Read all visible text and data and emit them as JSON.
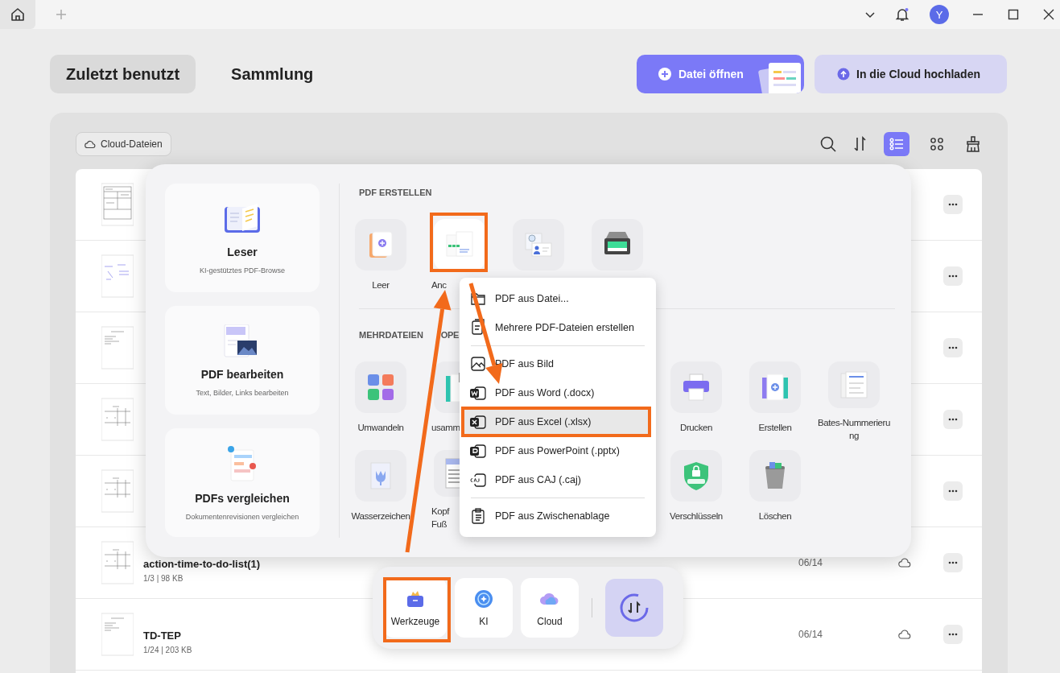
{
  "titlebar": {
    "avatar": "Y"
  },
  "tabs": [
    {
      "label": "Zuletzt benutzt",
      "selected": true
    },
    {
      "label": "Sammlung",
      "selected": false
    }
  ],
  "actions": [
    {
      "label": "Datei öffnen",
      "kind": "primary"
    },
    {
      "label": "In die Cloud hochladen",
      "kind": "secondary"
    }
  ],
  "filter": {
    "label": "Cloud-Dateien"
  },
  "view_modes": [
    {
      "kind": "list",
      "selected": true
    },
    {
      "kind": "grid",
      "selected": false
    }
  ],
  "files": [
    {
      "kind": "covered"
    },
    {
      "kind": "covered"
    },
    {
      "kind": "covered"
    },
    {
      "kind": "covered"
    },
    {
      "kind": "covered"
    },
    {
      "kind": "file",
      "title": "action-time-to-do-list(1)",
      "meta": "1/3 | 98 KB",
      "date": "06/14"
    },
    {
      "kind": "file",
      "title": "TD-TEP",
      "meta": "1/24 | 203 KB",
      "date": "06/14"
    }
  ],
  "tools_panel": {
    "cards": [
      {
        "kind": "reader",
        "title": "Leser",
        "subtitle": "KI-gestütztes PDF-Browse"
      },
      {
        "kind": "edit",
        "title": "PDF bearbeiten",
        "subtitle": "Text, Bilder, Links bearbeiten"
      },
      {
        "kind": "compare",
        "title": "PDFs vergleichen",
        "subtitle": "Dokumentenrevisionen vergleichen"
      }
    ],
    "sections": [
      {
        "heading": "PDF ERSTELLEN",
        "rows": [
          [
            {
              "kind": "blank",
              "label": "Leer"
            },
            {
              "kind": "sheets",
              "label": "Anc"
            },
            {
              "kind": "idcard"
            },
            {
              "kind": "scanner"
            }
          ]
        ]
      },
      {
        "heading": "MEHRDATEIEN",
        "heading_rest": "OPE",
        "rows": [
          [
            {
              "kind": "convert",
              "label": "Umwandeln"
            },
            {
              "kind": "merge",
              "label": "usamm"
            },
            {
              "kind": "covered"
            },
            {
              "kind": "covered"
            },
            {
              "kind": "print",
              "label": "Drucken"
            },
            {
              "kind": "create",
              "label": "Erstellen"
            },
            {
              "kind": "bates",
              "label": "Bates-Nummerierung"
            }
          ],
          [
            {
              "kind": "watermark",
              "label": "Wasserzeichen"
            },
            {
              "kind": "header",
              "label": "Kopf\nFuß"
            },
            {
              "kind": "covered"
            },
            {
              "kind": "covered"
            },
            {
              "kind": "encrypt",
              "label": "Verschlüsseln"
            },
            {
              "kind": "trash",
              "label": "Löschen"
            }
          ]
        ]
      }
    ]
  },
  "context_menu": {
    "groups": [
      [
        {
          "kind": "folder",
          "label": "PDF aus Datei...",
          "selected": false
        },
        {
          "kind": "multi",
          "label": "Mehrere PDF-Dateien erstellen",
          "selected": false
        }
      ],
      [
        {
          "kind": "image",
          "label": "PDF aus Bild",
          "selected": false
        },
        {
          "kind": "word",
          "label": "PDF aus Word (.docx)",
          "selected": false
        },
        {
          "kind": "excel",
          "label": "PDF aus Excel (.xlsx)",
          "selected": true
        },
        {
          "kind": "ppt",
          "label": "PDF aus PowerPoint (.pptx)",
          "selected": false
        },
        {
          "kind": "caj",
          "label": "PDF aus CAJ (.caj)",
          "selected": false
        }
      ],
      [
        {
          "kind": "clipboard",
          "label": "PDF aus Zwischenablage",
          "selected": false
        }
      ]
    ]
  },
  "dock": {
    "items": [
      {
        "kind": "tools",
        "label": "Werkzeuge"
      },
      {
        "kind": "ai",
        "label": "KI"
      },
      {
        "kind": "cloud",
        "label": "Cloud"
      }
    ]
  }
}
